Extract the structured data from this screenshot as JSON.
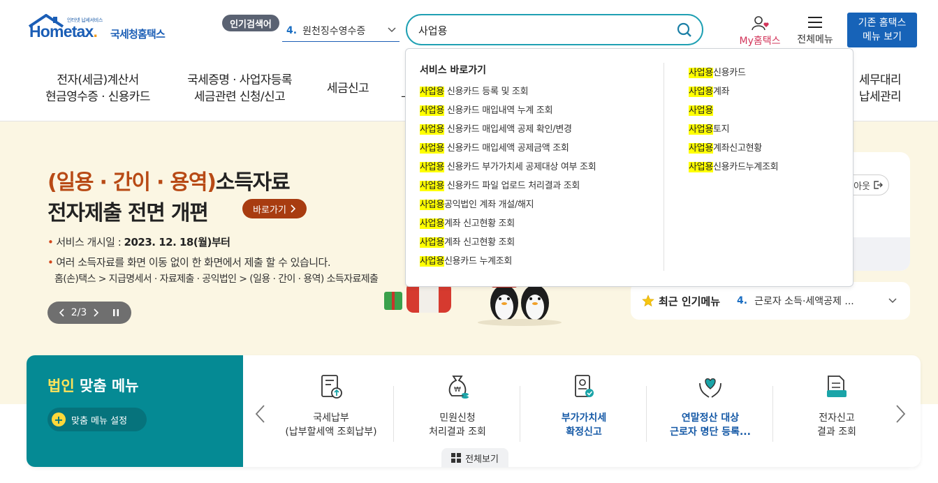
{
  "header": {
    "logo": {
      "small_tag": "인터넷 납세서비스",
      "word": "Hometax",
      "kor": "국세청홈택스"
    },
    "hot_badge": "인기검색어",
    "hot_select": {
      "num": "4.",
      "text": "원천징수영수증"
    },
    "search": {
      "value": "사업용"
    },
    "my_home": "My홈택스",
    "all_menu": "전체메뉴",
    "old_button": [
      "기존 홈택스",
      "메뉴 보기"
    ]
  },
  "gnb": [
    {
      "line1": "전자(세금)계산서",
      "line2": "현금영수증 · 신용카드"
    },
    {
      "line1": "국세증명 · 사업자등록",
      "line2": "세금관련 신청/신고"
    },
    {
      "line1": "세금신고",
      "line2": ""
    },
    {
      "line1": "세무대리",
      "line2": "납세관리"
    }
  ],
  "dropdown": {
    "section_title": "서비스 바로가기",
    "left_items": [
      {
        "hl": "사업용",
        "rest": " 신용카드 등록 및 조회"
      },
      {
        "hl": "사업용",
        "rest": " 신용카드 매입내역 누계 조회"
      },
      {
        "hl": "사업용",
        "rest": " 신용카드 매입세액 공제 확인/변경"
      },
      {
        "hl": "사업용",
        "rest": " 신용카드 매입세액 공제금액 조회"
      },
      {
        "hl": "사업용",
        "rest": " 신용카드 부가가치세 공제대상 여부 조회"
      },
      {
        "hl": "사업용",
        "rest": " 신용카드 파일 업로드 처리결과 조회"
      },
      {
        "hl": "사업용",
        "rest": "공익법인 계좌 개설/해지"
      },
      {
        "hl": "사업용",
        "rest": "계좌 신고현황 조회"
      },
      {
        "hl": "사업용",
        "rest": "계좌 신고현황 조회"
      },
      {
        "hl": "사업용",
        "rest": "신용카드 누계조회"
      }
    ],
    "right_items": [
      {
        "hl": "사업용",
        "rest": "신용카드"
      },
      {
        "hl": "사업용",
        "rest": "계좌"
      },
      {
        "hl": "사업용",
        "rest": ""
      },
      {
        "hl": "사업용",
        "rest": "토지"
      },
      {
        "hl": "사업용",
        "rest": "계좌신고현황"
      },
      {
        "hl": "사업용",
        "rest": "신용카드누계조회"
      }
    ]
  },
  "banner": {
    "title1_hl": "(일용 · 간이 · 용역)",
    "title1_rest": "소득자료",
    "title2": "전자제출 전면 개편",
    "go_button": "바로가기",
    "bullet1_label": "서비스 개시일 : ",
    "bullet1_value": "2023. 12. 18(월)부터",
    "bullet2": "여러 소득자료를 화면 이동 없이 한 화면에서 제출 할 수 있습니다.",
    "path": "홈(손)택스 > 지급명세서 · 자료제출 · 공익법인 > (일용 · 간이 · 용역) 소득자료제출",
    "pager": "2/3",
    "logout_partial": "아웃"
  },
  "popular_menu": {
    "label": "최근 인기메뉴",
    "num": "4.",
    "text": "근로자 소득·세액공제 ..."
  },
  "custom_menu": {
    "title_hl": "법인",
    "title_rest": " 맞춤 메뉴",
    "setting": "맞춤 메뉴 설정",
    "items": [
      {
        "line1": "국세납부",
        "line2": "(납부할세액 조회납부)",
        "bold": false
      },
      {
        "line1": "민원신청",
        "line2": "처리결과 조회",
        "bold": false
      },
      {
        "line1": "부가가치세",
        "line2": "확정신고",
        "bold": true
      },
      {
        "line1": "연말정산 대상",
        "line2": "근로자 명단 등록...",
        "bold": true
      },
      {
        "line1": "전자신고",
        "line2": "결과 조회",
        "bold": false
      }
    ],
    "view_all": "전체보기"
  },
  "colors": {
    "accent_teal": "#058a94",
    "brand_blue": "#1763b8",
    "highlight": "#ffff00",
    "banner_bg": "#fbf6e3"
  },
  "icons": [
    "home-roof-icon",
    "chevron-down-icon",
    "search-icon",
    "user-heart-icon",
    "hamburger-icon",
    "chevron-right-icon",
    "logout-icon",
    "star-icon",
    "pause-icon",
    "plus-icon",
    "tax-payment-icon",
    "money-bag-icon",
    "vat-doc-icon",
    "heart-hands-icon",
    "e-filing-icon",
    "grid-icon"
  ]
}
